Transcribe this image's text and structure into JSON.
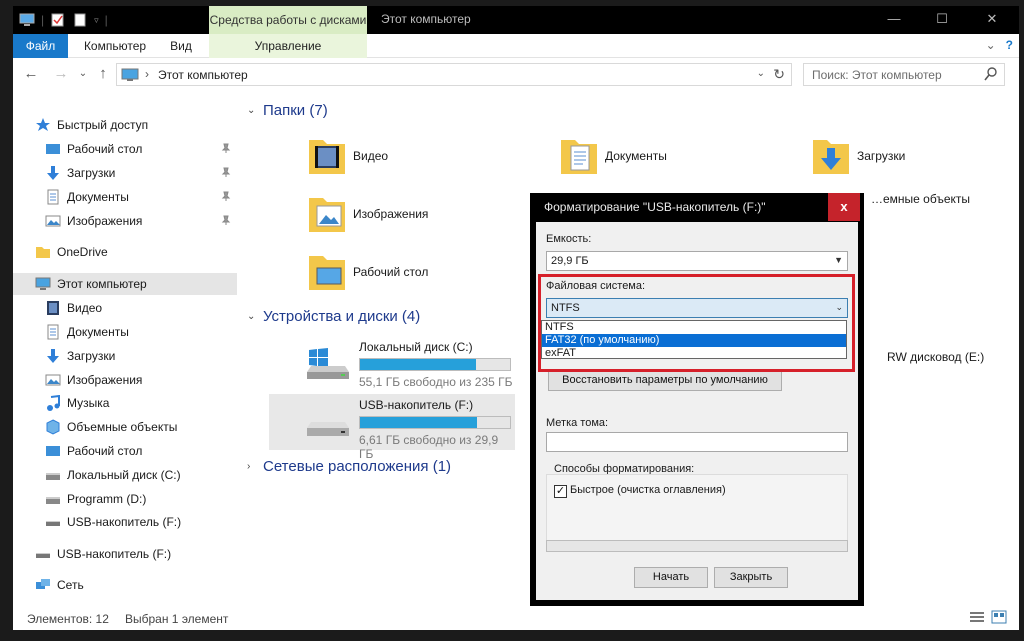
{
  "titlebar": {
    "context_tab": "Средства работы с дисками",
    "window_title": "Этот компьютер",
    "minimize": "—",
    "maximize": "☐",
    "close": "✕"
  },
  "ribbon": {
    "tabs": [
      "Файл",
      "Компьютер",
      "Вид",
      "Управление"
    ],
    "expand_icon": "⌄",
    "help_icon": "?"
  },
  "address": {
    "back": "←",
    "forward": "→",
    "up_menu": "⌄",
    "up": "↑",
    "crumb_sep": "›",
    "path": "Этот компьютер",
    "dropdown": "⌄",
    "refresh": "↻",
    "search_placeholder": "Поиск: Этот компьютер"
  },
  "sidebar": {
    "items": [
      {
        "label": "Быстрый доступ",
        "icon": "star-icon"
      },
      {
        "label": "Рабочий стол",
        "icon": "desktop-icon",
        "pinned": true
      },
      {
        "label": "Загрузки",
        "icon": "download-icon",
        "pinned": true
      },
      {
        "label": "Документы",
        "icon": "document-icon",
        "pinned": true
      },
      {
        "label": "Изображения",
        "icon": "image-icon",
        "pinned": true
      },
      {
        "label": "OneDrive",
        "icon": "onedrive-icon"
      },
      {
        "label": "Этот компьютер",
        "icon": "computer-icon",
        "selected": true
      },
      {
        "label": "Видео",
        "icon": "video-icon"
      },
      {
        "label": "Документы",
        "icon": "document-icon"
      },
      {
        "label": "Загрузки",
        "icon": "download-icon"
      },
      {
        "label": "Изображения",
        "icon": "image-icon"
      },
      {
        "label": "Музыка",
        "icon": "music-icon"
      },
      {
        "label": "Объемные объекты",
        "icon": "3d-objects-icon"
      },
      {
        "label": "Рабочий стол",
        "icon": "desktop-icon"
      },
      {
        "label": "Локальный диск (C:)",
        "icon": "drive-icon"
      },
      {
        "label": "Programm (D:)",
        "icon": "drive-icon"
      },
      {
        "label": "USB-накопитель (F:)",
        "icon": "usb-drive-icon"
      },
      {
        "label": "USB-накопитель (F:)",
        "icon": "usb-drive-icon"
      },
      {
        "label": "Сеть",
        "icon": "network-icon"
      }
    ],
    "pin_glyph": "📌"
  },
  "content": {
    "groups": {
      "folders": "Папки (7)",
      "devices": "Устройства и диски (4)",
      "network": "Сетевые расположения (1)"
    },
    "folders": [
      {
        "label": "Видео",
        "icon": "video-folder-icon"
      },
      {
        "label": "Документы",
        "icon": "documents-folder-icon"
      },
      {
        "label": "Загрузки",
        "icon": "downloads-folder-icon"
      },
      {
        "label": "Изображения",
        "icon": "pictures-folder-icon"
      },
      {
        "label": "…емные объекты",
        "icon": "3d-objects-folder-icon"
      },
      {
        "label": "Рабочий стол",
        "icon": "desktop-folder-icon"
      }
    ],
    "drives": [
      {
        "label": "Локальный диск (C:)",
        "free": "55,1 ГБ свободно из 235 ГБ",
        "used_fraction": 0.77
      },
      {
        "label": "USB-накопитель (F:)",
        "free": "6,61 ГБ свободно из 29,9 ГБ",
        "used_fraction": 0.78,
        "selected": true
      }
    ],
    "dvd_label": "RW дисковод (E:)"
  },
  "status": {
    "items_count": "Элементов: 12",
    "selected": "Выбран 1 элемент"
  },
  "format_dialog": {
    "title": "Форматирование \"USB-накопитель (F:)\"",
    "close": "x",
    "capacity_label": "Емкость:",
    "capacity_value": "29,9 ГБ",
    "fs_label": "Файловая система:",
    "fs_value": "NTFS",
    "fs_options": [
      "NTFS",
      "FAT32 (по умолчанию)",
      "exFAT"
    ],
    "fs_highlighted": 1,
    "restore_button": "Восстановить параметры по умолчанию",
    "volume_label": "Метка тома:",
    "volume_value": "",
    "format_options_label": "Способы форматирования:",
    "quick_label": "Быстрое (очистка оглавления)",
    "quick_checked": true,
    "progress": 0,
    "start_button": "Начать",
    "close_button": "Закрыть"
  },
  "colors": {
    "accent": "#1979ca",
    "context_tab": "#d9ecc4",
    "drive_bar": "#26a0da",
    "highlight_box": "#d6202a",
    "close_red": "#c5232b"
  }
}
